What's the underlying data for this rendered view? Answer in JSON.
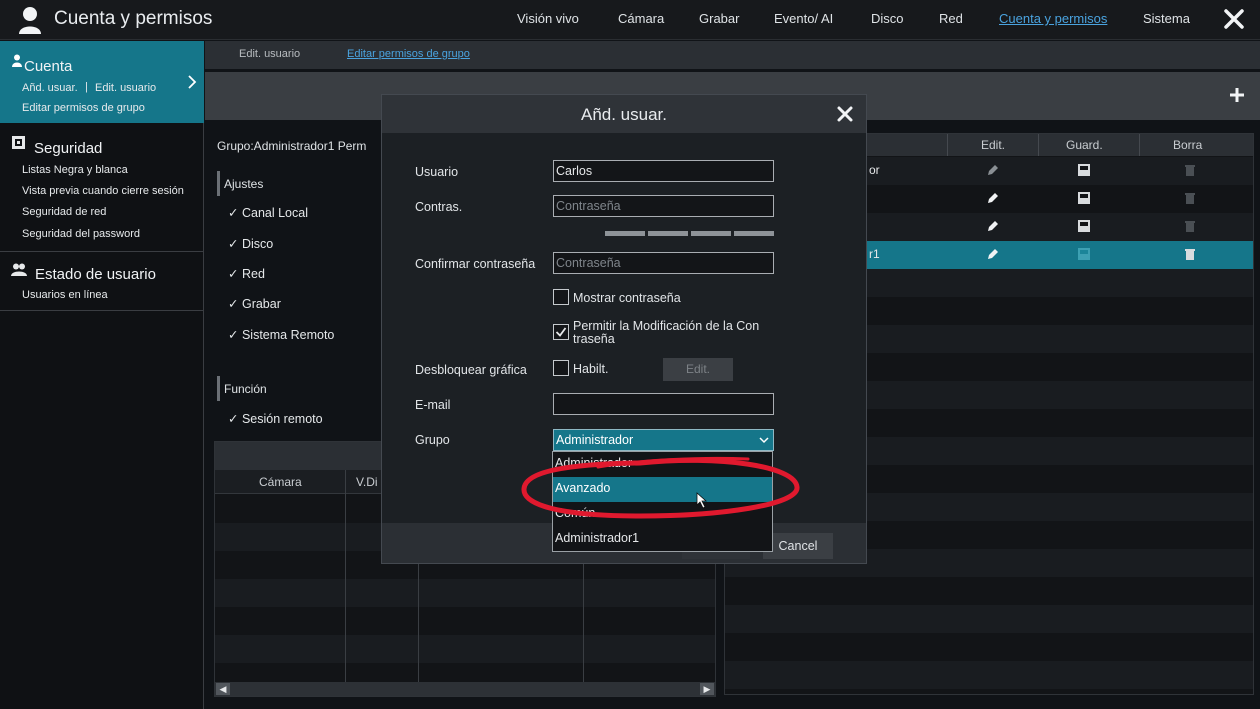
{
  "app": {
    "title": "Cuenta y permisos"
  },
  "topnav": [
    {
      "label": "Visión vivo"
    },
    {
      "label": "Cámara"
    },
    {
      "label": "Grabar"
    },
    {
      "label": "Evento/ AI"
    },
    {
      "label": "Disco"
    },
    {
      "label": "Red"
    },
    {
      "label": "Cuenta y permisos",
      "active": true
    },
    {
      "label": "Sistema"
    }
  ],
  "sidebar": {
    "cuenta": {
      "label": "Cuenta",
      "sub1": "Añd. usuar.",
      "sep": "|",
      "sub2": "Edit. usuario",
      "sub3": "Editar permisos de grupo"
    },
    "seguridad": {
      "label": "Seguridad",
      "items": [
        "Listas Negra y blanca",
        "Vista previa cuando cierre sesión",
        "Seguridad de red",
        "Seguridad del password"
      ]
    },
    "estado": {
      "label": "Estado de usuario",
      "items": [
        "Usuarios en línea"
      ]
    }
  },
  "subtabs": {
    "edit_user": "Edit. usuario",
    "edit_group": "Editar permisos de grupo"
  },
  "group_panel": {
    "group_label": "Grupo:Administrador1  Perm",
    "settings_title": "Ajustes",
    "settings": [
      "Canal Local",
      "Disco",
      "Red",
      "Grabar",
      "Sistema Remoto"
    ],
    "function_title": "Función",
    "functions": [
      "Sesión remoto"
    ],
    "check": "✓"
  },
  "bottom_table": {
    "columns": [
      "Cámara",
      "V.Di"
    ]
  },
  "user_table": {
    "columns": [
      "Edit.",
      "Guard.",
      "Borra"
    ],
    "rows": [
      {
        "name_fragment": "or"
      },
      {
        "name_fragment": ""
      },
      {
        "name_fragment": ""
      },
      {
        "name_fragment": "r1",
        "selected": true
      }
    ]
  },
  "modal": {
    "title": "Añd. usuar.",
    "user_label": "Usuario",
    "user_value": "Carlos",
    "pass_label": "Contras.",
    "pass_placeholder": "Contraseña",
    "confirm_label": "Confirmar contraseña",
    "confirm_placeholder": "Contraseña",
    "show_password": "Mostrar contraseña",
    "allow_modify_line1": "Permitir la Modificación de la Con",
    "allow_modify_line2": "traseña",
    "unlock_label": "Desbloquear gráfica",
    "enable_label": "Habilt.",
    "edit_button": "Edit.",
    "email_label": "E-mail",
    "email_value": "",
    "group_label": "Grupo",
    "group_selected": "Administrador",
    "cancel_button": "Cancel",
    "show_password_checked": false,
    "allow_modify_checked": true,
    "enable_checked": false
  },
  "dropdown": {
    "options": [
      "Administrador",
      "Avanzado",
      "Común",
      "Administrador1"
    ],
    "highlighted": "Avanzado"
  },
  "colors": {
    "accent": "#15768a",
    "link": "#4aa3df",
    "annotation": "#e0192e"
  }
}
